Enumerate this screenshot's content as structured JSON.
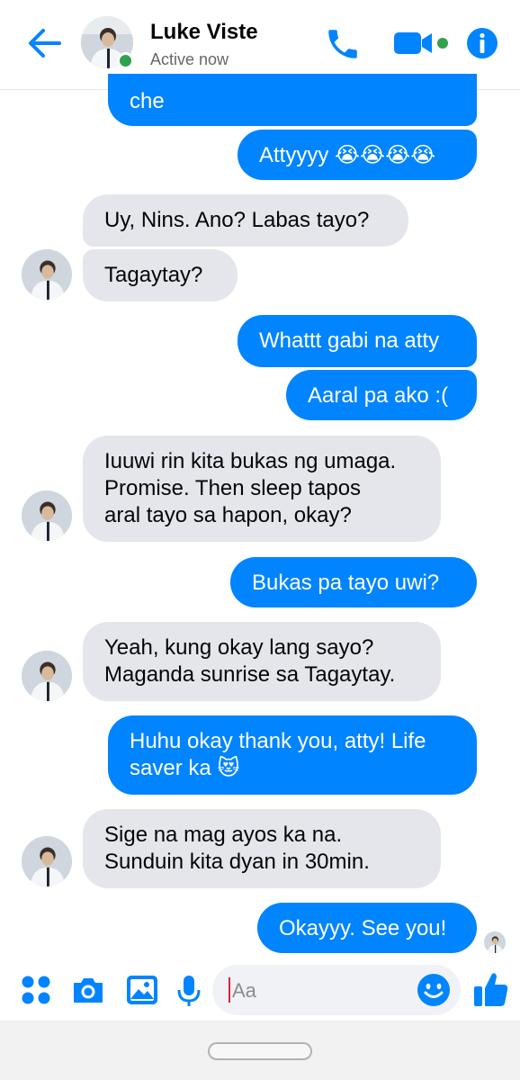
{
  "header": {
    "contact_name": "Luke Viste",
    "status": "Active now",
    "accent": "#0084ff",
    "online_color": "#31a24c"
  },
  "messages": [
    {
      "dir": "out",
      "text": "che"
    },
    {
      "dir": "out",
      "text": "Attyyyy 😭😭😭😭"
    },
    {
      "dir": "in",
      "text": "Uy, Nins. Ano? Labas tayo?"
    },
    {
      "dir": "in",
      "text": "Tagaytay?"
    },
    {
      "dir": "out",
      "text": "Whattt gabi na atty"
    },
    {
      "dir": "out",
      "text": "Aaral pa ako :("
    },
    {
      "dir": "in",
      "text": "Iuuwi rin kita bukas ng umaga.\nPromise. Then sleep tapos\naral tayo sa hapon, okay?"
    },
    {
      "dir": "out",
      "text": "Bukas pa tayo uwi?"
    },
    {
      "dir": "in",
      "text": "Yeah, kung okay lang sayo?\nMaganda sunrise sa Tagaytay."
    },
    {
      "dir": "out",
      "text": "Huhu okay thank you, atty! Life\nsaver ka 😻"
    },
    {
      "dir": "in",
      "text": "Sige na mag ayos ka na.\nSunduin kita dyan in 30min."
    },
    {
      "dir": "out",
      "text": "Okayyy. See you!"
    }
  ],
  "composer": {
    "placeholder": "Aa"
  },
  "icons": {
    "back": "arrow-left-icon",
    "call": "phone-icon",
    "video": "video-camera-icon",
    "info": "info-icon",
    "menu": "four-dots-icon",
    "camera": "camera-icon",
    "gallery": "image-icon",
    "mic": "microphone-icon",
    "emoji": "smiley-icon",
    "like": "thumbs-up-icon"
  }
}
